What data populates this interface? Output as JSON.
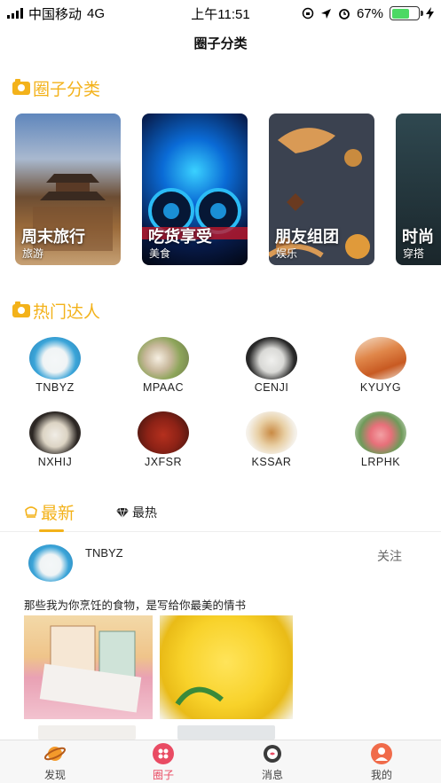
{
  "status_bar": {
    "carrier": "中国移动",
    "network": "4G",
    "time": "上午11:51",
    "battery": "67%",
    "battery_level": 0.67
  },
  "nav": {
    "title": "圈子分类"
  },
  "categories_section": {
    "title": "圈子分类",
    "items": [
      {
        "name": "周末旅行",
        "sub": "旅游"
      },
      {
        "name": "吃货享受",
        "sub": "美食"
      },
      {
        "name": "朋友组团",
        "sub": "娱乐"
      },
      {
        "name": "时尚",
        "sub": "穿搭"
      }
    ]
  },
  "talents_section": {
    "title": "热门达人",
    "items": [
      {
        "name": "TNBYZ"
      },
      {
        "name": "MPAAC"
      },
      {
        "name": "CENJI"
      },
      {
        "name": "KYUYG"
      },
      {
        "name": "NXHIJ"
      },
      {
        "name": "JXFSR"
      },
      {
        "name": "KSSAR"
      },
      {
        "name": "LRPHK"
      }
    ]
  },
  "feed_tabs": {
    "latest": "最新",
    "hot": "最热"
  },
  "post": {
    "user": "TNBYZ",
    "follow": "关注",
    "text": "那些我为你烹饪的食物，是写给你最美的情书"
  },
  "tabbar": {
    "items": [
      {
        "label": "发现"
      },
      {
        "label": "圈子"
      },
      {
        "label": "消息"
      },
      {
        "label": "我的"
      }
    ]
  },
  "colors": {
    "accent": "#f3b21a",
    "active_tab": "#e94b63"
  }
}
